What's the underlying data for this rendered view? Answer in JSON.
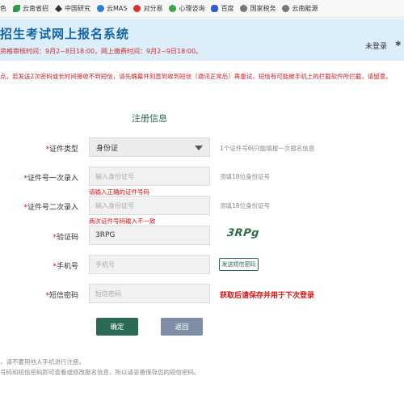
{
  "bookmarks": [
    {
      "label": "色",
      "icon": "bookmark-icon",
      "color": "#8a8a8a"
    },
    {
      "label": "云南省招",
      "icon": "yn-leaf-icon",
      "color": "#2e9a4b"
    },
    {
      "label": "中国研究",
      "icon": "bird-icon",
      "color": "#333333"
    },
    {
      "label": "云MAS",
      "icon": "cloud-icon",
      "color": "#2f7fd1"
    },
    {
      "label": "对分易",
      "icon": "red-circle-icon",
      "color": "#d6332a"
    },
    {
      "label": "心理咨询",
      "icon": "green-circle-icon",
      "color": "#3ba34a"
    },
    {
      "label": "百度",
      "icon": "baidu-paw-icon",
      "color": "#2d5fd3"
    },
    {
      "label": "国家税务",
      "icon": "emblem-icon",
      "color": "#777777"
    },
    {
      "label": "云南能源",
      "icon": "globe-icon",
      "color": "#777777"
    }
  ],
  "header": {
    "title": "招生考试网上报名系统",
    "deadline": "资格审核时间：9月2~8日18:00，网上缴费时间：9月2~9日18:00。",
    "login_status": "未登录",
    "colors": {
      "background": "#ddeefb",
      "title": "#1565a6",
      "deadline": "#cc2a2a"
    }
  },
  "notice": "点，若发送2次密码或长时间接收不到短信，请先确幕并刻直到收到短信（通讯正常后）再重试，短信有可能被手机上的拦截软件所拦截，请留意。",
  "form": {
    "title": "注册信息",
    "fields": {
      "id_type": {
        "label": "证件类型",
        "value": "身份证",
        "hint": "1个证件号码只能填报一次报名信息"
      },
      "id_first": {
        "label": "证件号一次录入",
        "placeholder": "输入身份证号",
        "hint": "须填18位身份证号",
        "error": "请输入正确的证件号码"
      },
      "id_second": {
        "label": "证件号二次录入",
        "placeholder": "输入身份证号",
        "hint": "须填18位身份证号",
        "error": "两次证件号码输入不一致"
      },
      "captcha": {
        "label": "验证码",
        "value": "3RPG",
        "image_text": "3RPg"
      },
      "phone": {
        "label": "手机号",
        "placeholder": "手机号",
        "button": "发送短信密码"
      },
      "sms_password": {
        "label": "短信密码",
        "placeholder": "短信密码",
        "hint": "获取后请保存并用于下次登录"
      }
    },
    "required_mark": "*",
    "buttons": {
      "confirm": "确定",
      "back": "返回"
    }
  },
  "footnotes": [
    "，请不要用他人手机进行注册。",
    "号码和短信密码即可查看或修改报名信息，所以请妥善保存您的短信密码。"
  ],
  "colors": {
    "accent": "#2a6a55",
    "error": "#dd1111",
    "back_button": "#7e8ea6"
  }
}
